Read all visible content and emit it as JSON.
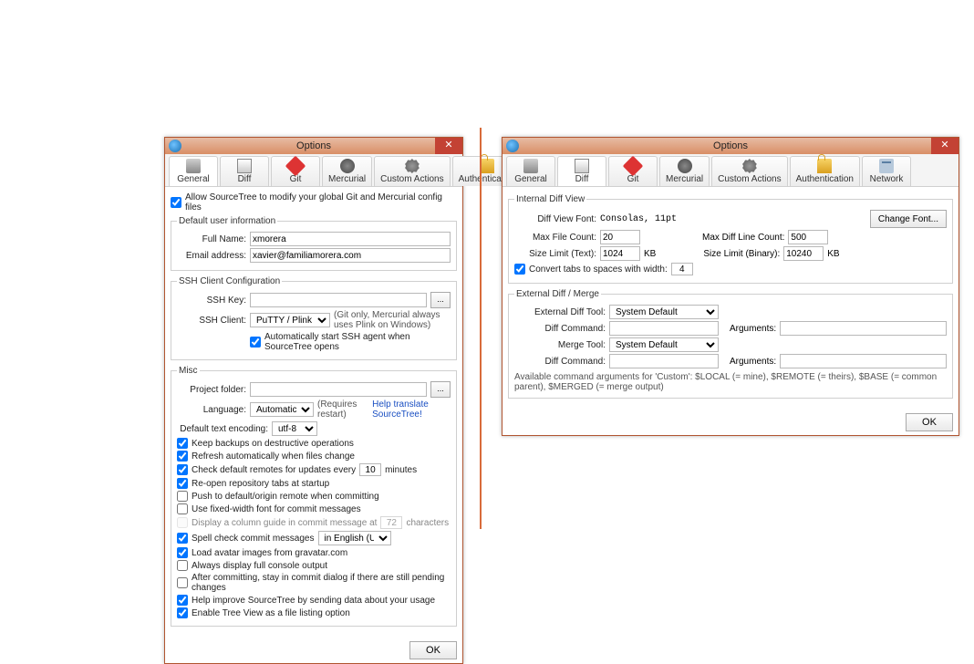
{
  "window_title": "Options",
  "close_glyph": "✕",
  "ok_label": "OK",
  "browse_glyph": "...",
  "tabs": {
    "general": "General",
    "diff": "Diff",
    "git": "Git",
    "mercurial": "Mercurial",
    "custom": "Custom Actions",
    "auth": "Authentication",
    "network": "Network"
  },
  "general": {
    "allow_modify": "Allow SourceTree to modify your global Git and Mercurial config files",
    "group_user": "Default user information",
    "full_name_label": "Full Name:",
    "full_name_value": "xmorera",
    "email_label": "Email address:",
    "email_value": "xavier@familiamorera.com",
    "group_ssh": "SSH Client Configuration",
    "ssh_key_label": "SSH Key:",
    "ssh_key_value": "",
    "ssh_client_label": "SSH Client:",
    "ssh_client_value": "PuTTY / Plink",
    "ssh_client_note": "(Git only, Mercurial always uses Plink on Windows)",
    "ssh_autostart": "Automatically start SSH agent when SourceTree opens",
    "group_misc": "Misc",
    "project_folder_label": "Project folder:",
    "project_folder_value": "",
    "language_label": "Language:",
    "language_value": "Automatic",
    "language_note": "(Requires restart)",
    "language_link": "Help translate SourceTree!",
    "encoding_label": "Default text encoding:",
    "encoding_value": "utf-8",
    "chk_keep_backups": "Keep backups on destructive operations",
    "chk_refresh_auto": "Refresh automatically when files change",
    "chk_check_remotes_pre": "Check default remotes for updates every",
    "chk_check_remotes_val": "10",
    "chk_check_remotes_post": "minutes",
    "chk_reopen_tabs": "Re-open repository tabs at startup",
    "chk_push_default": "Push to default/origin remote when committing",
    "chk_fixed_width": "Use fixed-width font for commit messages",
    "chk_column_guide_pre": "Display a column guide in commit message at",
    "chk_column_guide_val": "72",
    "chk_column_guide_post": "characters",
    "chk_spell_pre": "Spell check commit messages",
    "chk_spell_lang": "in English (US)",
    "chk_gravatar": "Load avatar images from gravatar.com",
    "chk_console": "Always display full console output",
    "chk_stay_commit": "After committing, stay in commit dialog if there are still pending changes",
    "chk_telemetry": "Help improve SourceTree by sending data about your usage",
    "chk_treeview": "Enable Tree View as a file listing option"
  },
  "diff": {
    "group_internal": "Internal Diff View",
    "font_label": "Diff View Font:",
    "font_value": "Consolas, 11pt",
    "change_font": "Change Font...",
    "max_file_count_label": "Max File Count:",
    "max_file_count_val": "20",
    "max_line_count_label": "Max Diff Line Count:",
    "max_line_count_val": "500",
    "size_text_label": "Size Limit (Text):",
    "size_text_val": "1024",
    "size_text_unit": "KB",
    "size_bin_label": "Size Limit (Binary):",
    "size_bin_val": "10240",
    "size_bin_unit": "KB",
    "convert_tabs_label": "Convert tabs to spaces with width:",
    "convert_tabs_val": "4",
    "group_external": "External Diff / Merge",
    "ext_diff_tool_label": "External Diff Tool:",
    "ext_diff_tool_val": "System Default",
    "diff_cmd_label": "Diff Command:",
    "diff_cmd_val": "",
    "diff_args_label": "Arguments:",
    "diff_args_val": "",
    "merge_tool_label": "Merge Tool:",
    "merge_tool_val": "System Default",
    "merge_cmd_label": "Diff Command:",
    "merge_cmd_val": "",
    "merge_args_label": "Arguments:",
    "merge_args_val": "",
    "args_note": "Available command arguments for 'Custom': $LOCAL (= mine), $REMOTE (= theirs), $BASE (= common parent), $MERGED (= merge output)"
  }
}
